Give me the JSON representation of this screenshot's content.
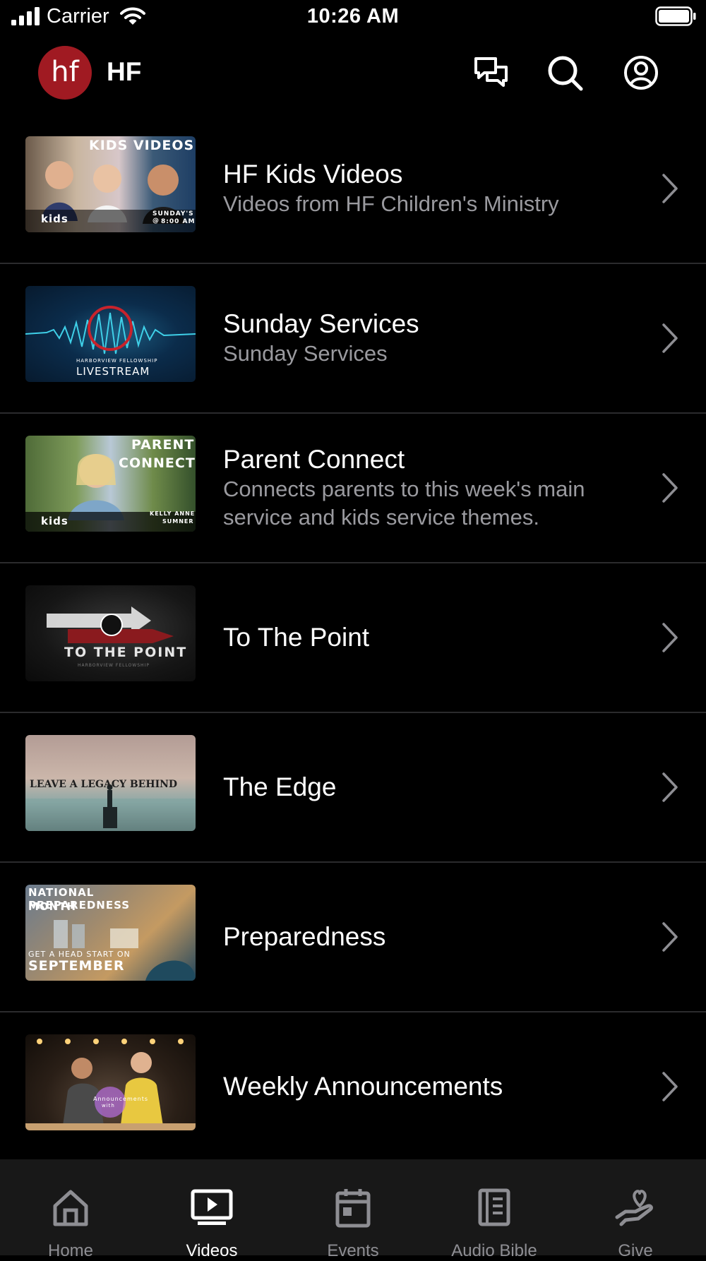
{
  "status_bar": {
    "carrier": "Carrier",
    "time": "10:26 AM"
  },
  "header": {
    "logo_text": "hf",
    "title": "HF"
  },
  "videos": [
    {
      "title": "HF Kids Videos",
      "subtitle": "Videos from HF Children's Ministry"
    },
    {
      "title": "Sunday Services",
      "subtitle": "Sunday Services"
    },
    {
      "title": "Parent Connect",
      "subtitle": "Connects parents to this week's main service and kids service themes."
    },
    {
      "title": "To The Point",
      "subtitle": ""
    },
    {
      "title": "The Edge",
      "subtitle": ""
    },
    {
      "title": "Preparedness",
      "subtitle": ""
    },
    {
      "title": "Weekly Announcements",
      "subtitle": ""
    }
  ],
  "thumbnails": {
    "kids": {
      "top": "KIDS VIDEOS",
      "brand": "kids",
      "schedule_1": "SUNDAY'S @",
      "schedule_2": "8:00 AM"
    },
    "services": {
      "org": "HARBORVIEW FELLOWSHIP",
      "label": "LIVESTREAM"
    },
    "parent": {
      "line1": "PARENT",
      "line2": "CONNECT",
      "brand": "kids",
      "name1": "KELLY ANNE",
      "name2": "SUMNER"
    },
    "point": {
      "title": "TO THE POINT",
      "org": "HARBORVIEW FELLOWSHIP"
    },
    "edge": {
      "text": "LEAVE A LEGACY BEHIND"
    },
    "prep": {
      "line1": "NATIONAL PREPAREDNESS",
      "line2": "MONTH",
      "line3": "GET A HEAD START ON",
      "line4": "SEPTEMBER"
    },
    "announce": {
      "text1": "Announcements",
      "text2": "with"
    }
  },
  "tabs": [
    {
      "label": "Home",
      "icon": "home-icon",
      "active": false
    },
    {
      "label": "Videos",
      "icon": "play-icon",
      "active": true
    },
    {
      "label": "Events",
      "icon": "calendar-icon",
      "active": false
    },
    {
      "label": "Audio Bible",
      "icon": "book-icon",
      "active": false
    },
    {
      "label": "Give",
      "icon": "heart-hand-icon",
      "active": false
    }
  ],
  "colors": {
    "background": "#000000",
    "logo": "#a01a22",
    "subtitle": "#9a9a9f",
    "tab_inactive": "#8e8e93",
    "tab_active": "#ffffff"
  }
}
